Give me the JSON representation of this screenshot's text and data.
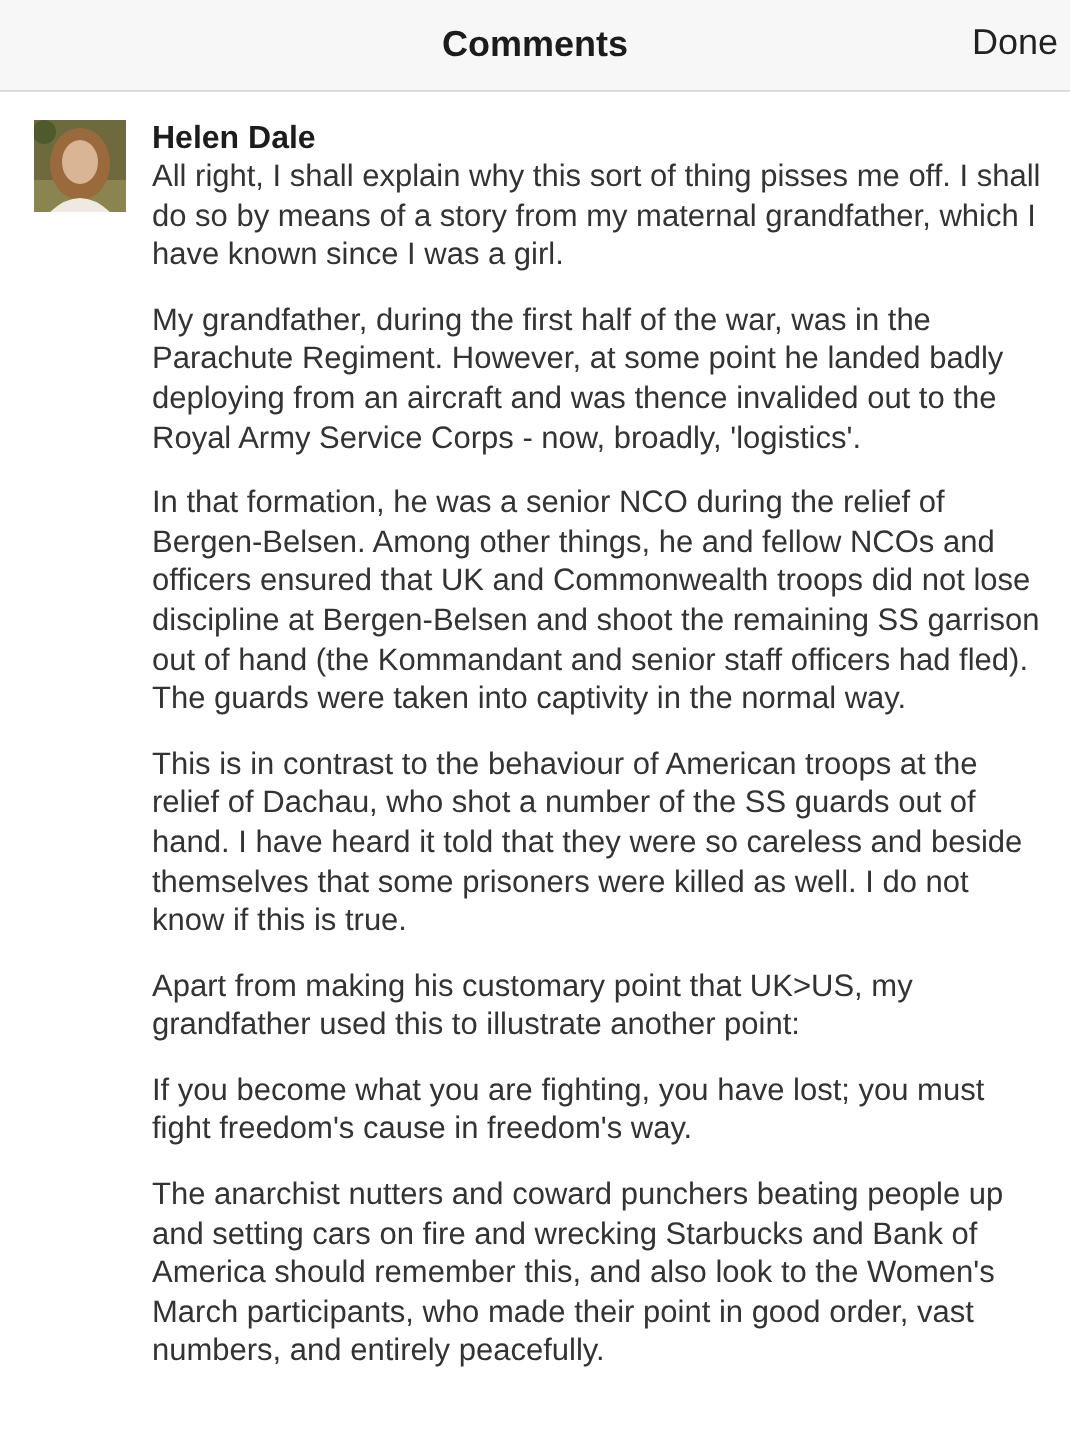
{
  "header": {
    "title": "Comments",
    "done_button": "Done"
  },
  "comments": [
    {
      "author": "Helen Dale",
      "paragraphs": [
        "All right, I shall explain why this sort of thing pisses me off. I shall do so by means of a story from my maternal grandfather, which I have known since I was a girl.",
        "My grandfather, during the first half of the war, was in the Parachute Regiment. However, at some point he landed badly deploying from an aircraft and was thence invalided out to the Royal Army Service Corps - now, broadly, 'logistics'.",
        "In that formation, he was a senior NCO during the relief of Bergen-Belsen. Among other things, he and fellow NCOs and officers ensured that UK and Commonwealth troops did not lose discipline at Bergen-Belsen and shoot the remaining SS garrison out of hand (the Kommandant and senior staff officers had fled). The guards were taken into captivity in the normal way.",
        "This is in contrast to the behaviour of American troops at the relief of Dachau, who shot a number of the SS guards out of hand. I have heard it told that they were so careless and beside themselves that some prisoners were killed as well. I do not know if this is true.",
        "Apart from making his customary point that UK>US, my grandfather used this to illustrate another point:",
        "If you become what you are fighting, you have lost; you must fight freedom's cause in freedom's way.",
        "The anarchist nutters and coward punchers beating people up and setting cars on fire and wrecking Starbucks and Bank of America should remember this, and also look to the Women's March participants, who made their point in good order, vast numbers, and entirely peacefully."
      ]
    }
  ]
}
